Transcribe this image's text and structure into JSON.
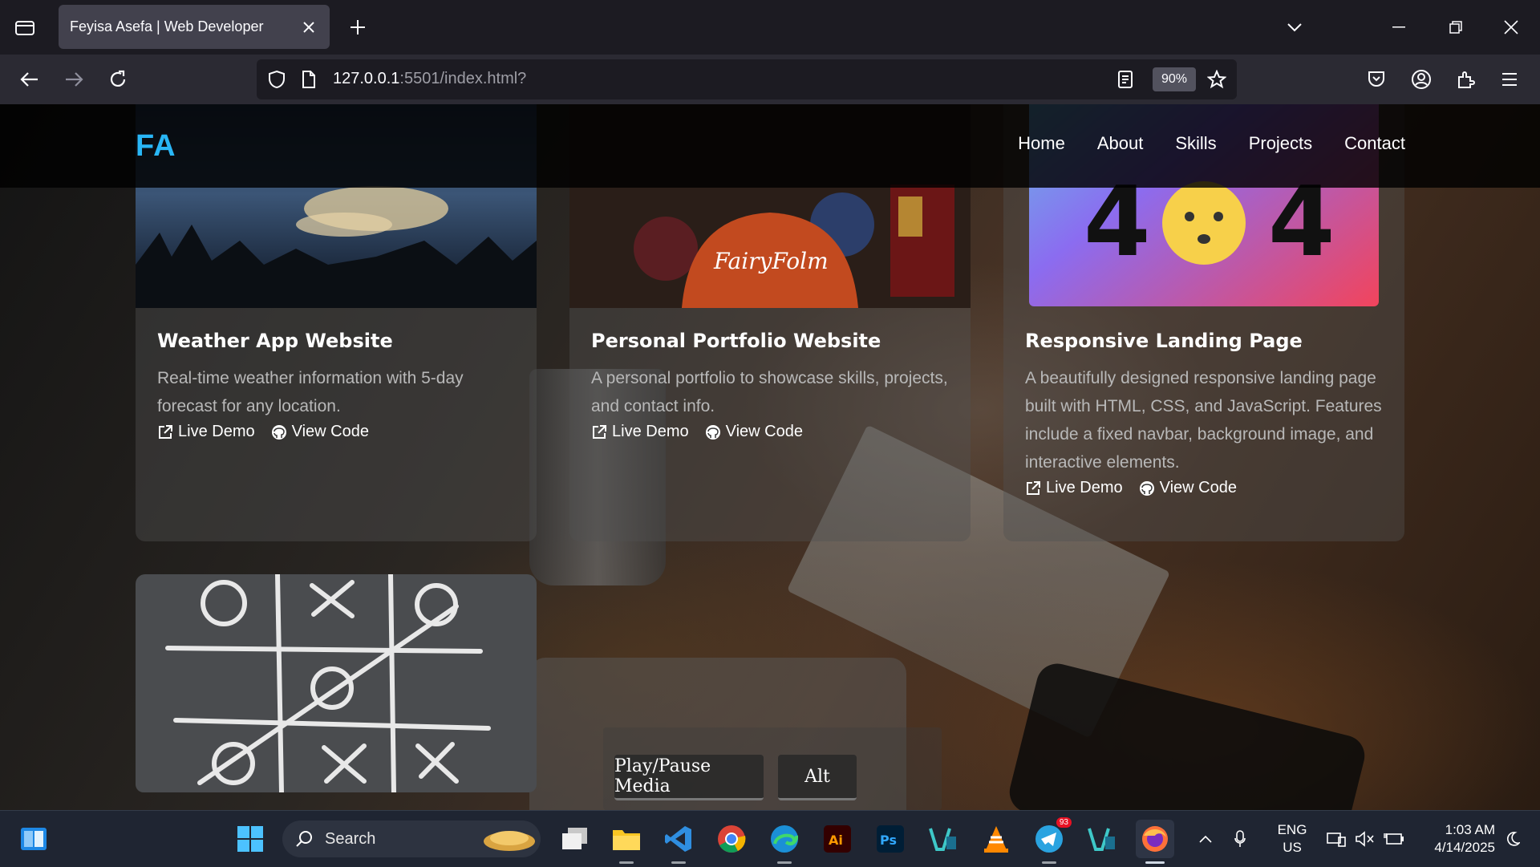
{
  "browser": {
    "tab_title": "Feyisa Asefa | Web Developer",
    "url_host": "127.0.0.1",
    "url_rest": ":5501/index.html?",
    "zoom": "90%"
  },
  "site": {
    "logo": "FA",
    "nav": [
      "Home",
      "About",
      "Skills",
      "Projects",
      "Contact"
    ],
    "projects": [
      {
        "title": "Weather App Website",
        "description": "Real-time weather information with 5-day forecast for any location.",
        "live_demo": "Live Demo",
        "view_code": "View Code"
      },
      {
        "title": "Personal Portfolio Website",
        "description": "A personal portfolio to showcase skills, projects, and contact info.",
        "live_demo": "Live Demo",
        "view_code": "View Code"
      },
      {
        "title": "Responsive Landing Page",
        "description": "A beautifully designed responsive landing page built with HTML, CSS, and JavaScript. Features include a fixed navbar, background image, and interactive elements.",
        "live_demo": "Live Demo",
        "view_code": "View Code"
      }
    ]
  },
  "key_overlay": {
    "keys": [
      "Play/Pause Media",
      "Alt"
    ]
  },
  "taskbar": {
    "search_label": "Search",
    "telegram_badge": "93",
    "lang_line1": "ENG",
    "lang_line2": "US",
    "time": "1:03 AM",
    "date": "4/14/2025"
  },
  "colors": {
    "logo": "#29b6f6",
    "chrome_dark": "#1c1b22",
    "chrome_toolbar": "#2b2a33",
    "taskbar": "#1f2532"
  }
}
